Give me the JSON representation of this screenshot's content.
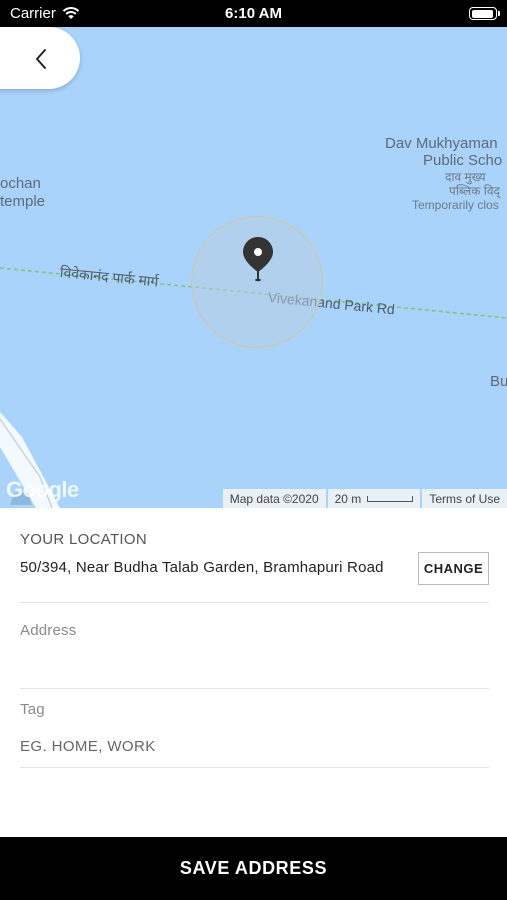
{
  "status_bar": {
    "carrier": "Carrier",
    "time": "6:10 AM",
    "icons": [
      "wifi-icon",
      "battery-icon"
    ]
  },
  "map": {
    "back_icon": "chevron-left-icon",
    "pin_icon": "map-pin-icon",
    "labels": {
      "poi_1_line_1": "Dav Mukhyaman",
      "poi_1_line_2": "Public Scho",
      "poi_1_hindi_1": "दाव मुख्य",
      "poi_1_hindi_2": "पब्लिक विद्",
      "poi_1_status": "Temporarily clos",
      "poi_2_line_1": "ochan",
      "poi_2_line_2": "temple",
      "edge_label": "Bu",
      "road_hindi": "विवेकानंद पार्क मार्ग",
      "road_english": "Vivekanand Park Rd"
    },
    "google_logo": "Google",
    "attribution": {
      "map_data": "Map data ©2020",
      "scale": "20 m",
      "terms": "Terms of Use"
    },
    "colors": {
      "water": "#aad3fb",
      "road_dash": "#7cc47c"
    }
  },
  "form": {
    "location_heading": "YOUR LOCATION",
    "location_value": "50/394, Near Budha Talab Garden, Bramhapuri Road",
    "change_label": "CHANGE",
    "address_label": "Address",
    "address_value": "",
    "tag_label": "Tag",
    "tag_placeholder": "EG. HOME, WORK",
    "tag_value": ""
  },
  "save_label": "SAVE ADDRESS"
}
